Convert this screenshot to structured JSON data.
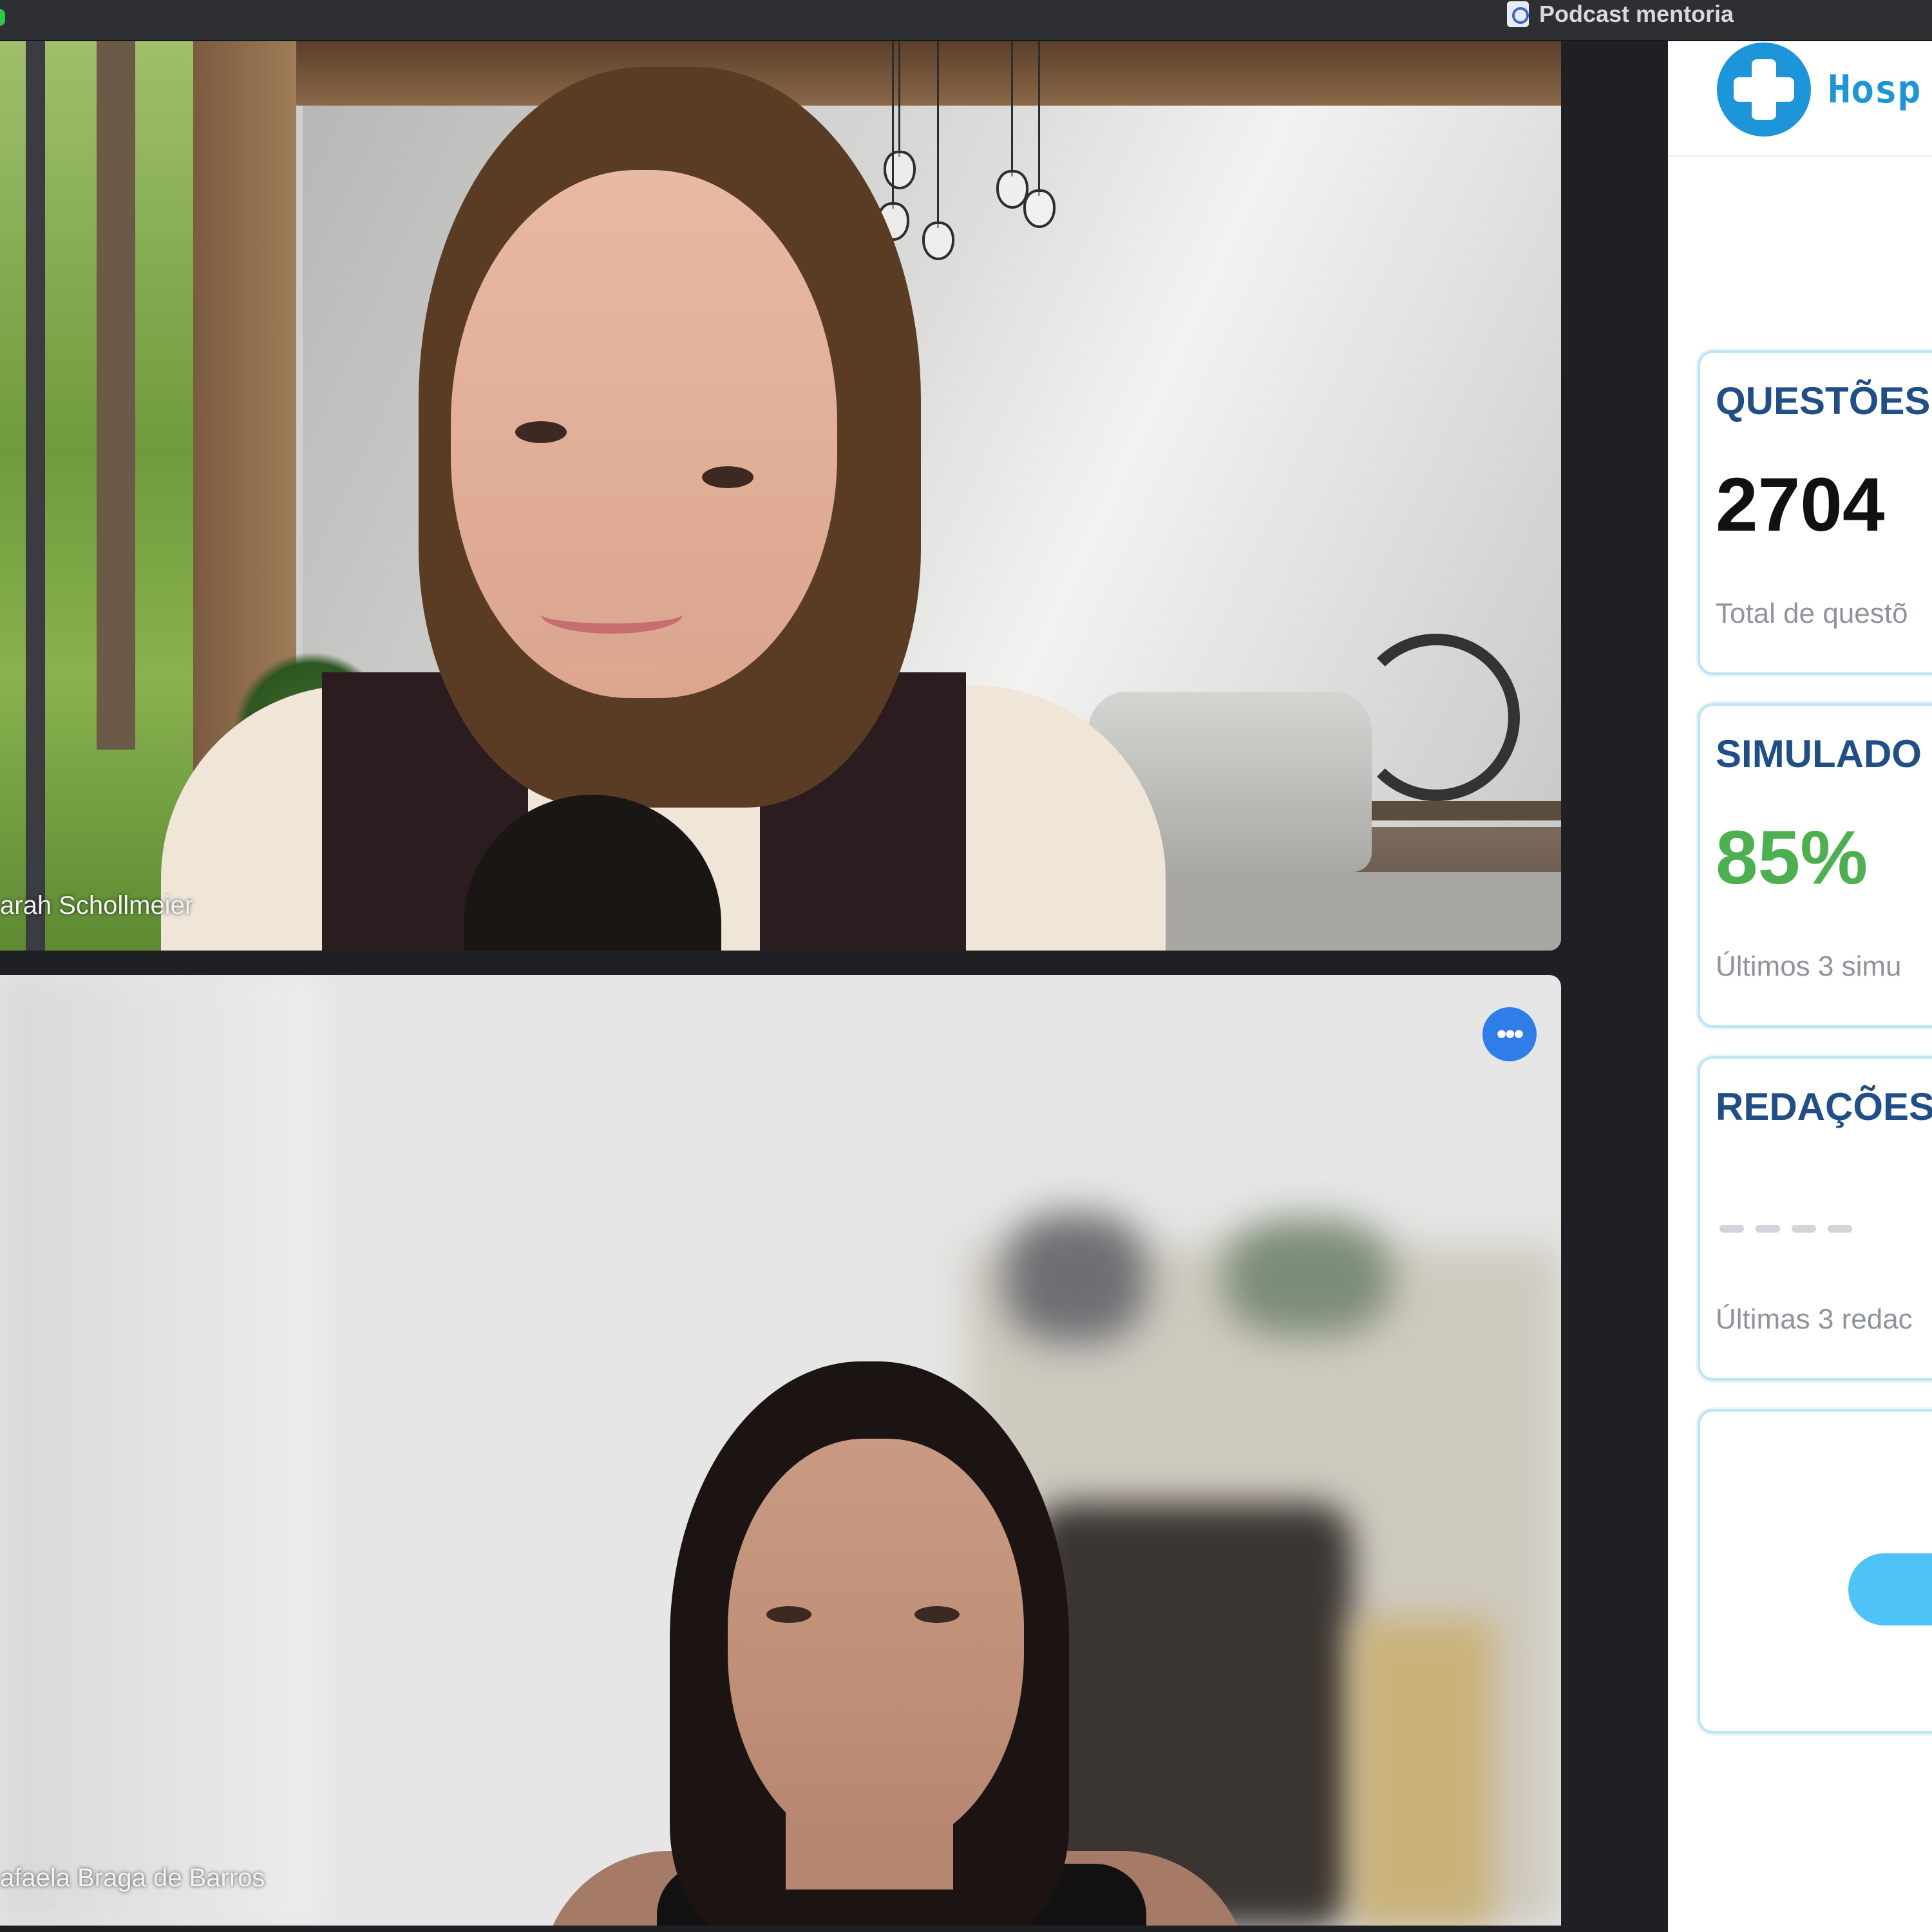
{
  "window": {
    "title": "Podcast mentoria"
  },
  "participants": [
    {
      "name": "arah Schollmeier"
    },
    {
      "name": "afaela Braga de Barros"
    }
  ],
  "panel": {
    "logo_text": "Hosp",
    "cards": [
      {
        "title": "QUESTÕES",
        "value": "2704",
        "subtitle": "Total de questõ",
        "value_color": "#111111"
      },
      {
        "title": "SIMULADO",
        "value": "85%",
        "subtitle": "Últimos 3 simu",
        "value_color": "#4caf50"
      },
      {
        "title": "REDAÇÕES",
        "value": "",
        "subtitle": "Últimas 3 redac",
        "value_color": "#111111"
      },
      {
        "title": "",
        "value": "",
        "subtitle": ""
      }
    ]
  },
  "colors": {
    "accent": "#1c96d8",
    "title_text": "#1f4f86",
    "success": "#4caf50",
    "card_border": "#bfe5f5",
    "more_button": "#2f7de8"
  },
  "icons": {
    "window_doc": "document-icon",
    "logo": "medical-cross-icon",
    "more": "more-options-icon"
  }
}
